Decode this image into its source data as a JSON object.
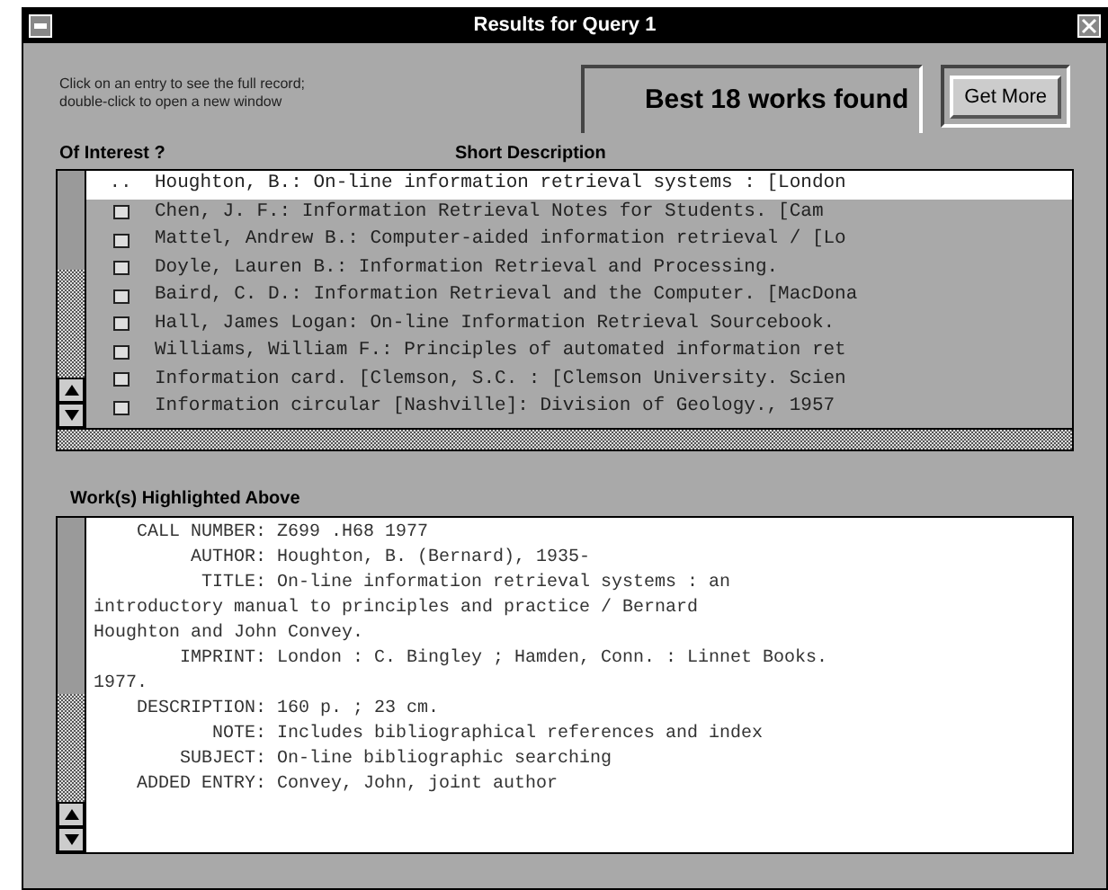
{
  "window": {
    "title": "Results for Query 1"
  },
  "instructions": "Click on an entry to see the full record;\ndouble-click to open a new window",
  "result_count": "Best 18 works found",
  "get_more_button": "Get More",
  "list": {
    "columns": [
      "Of Interest ?",
      "Short Description"
    ],
    "rows": [
      {
        "marker": "..",
        "text": "Houghton, B.: On-line information retrieval systems : [London",
        "selected": true
      },
      {
        "marker": "",
        "text": "Chen, J. F.: Information Retrieval  Notes for Students. [Cam",
        "selected": false
      },
      {
        "marker": "",
        "text": "Mattel, Andrew B.: Computer-aided information retrieval / [Lo",
        "selected": false
      },
      {
        "marker": "",
        "text": "Doyle, Lauren B.: Information Retrieval and Processing.",
        "selected": false
      },
      {
        "marker": "",
        "text": "Baird, C. D.: Information Retrieval and the Computer. [MacDona",
        "selected": false
      },
      {
        "marker": "",
        "text": "Hall, James Logan: On-line Information Retrieval Sourcebook.",
        "selected": false
      },
      {
        "marker": "",
        "text": "Williams, William F.: Principles of automated information ret",
        "selected": false
      },
      {
        "marker": "",
        "text": "Information card. [Clemson, S.C. : [Clemson University. Scien",
        "selected": false
      },
      {
        "marker": "",
        "text": "Information circular  [Nashville]: Division of Geology., 1957",
        "selected": false
      }
    ]
  },
  "detail": {
    "heading": "Work(s) Highlighted Above",
    "fields": [
      {
        "label": "CALL NUMBER:",
        "value": "Z699 .H68 1977"
      },
      {
        "label": "AUTHOR:",
        "value": "Houghton, B. (Bernard), 1935-"
      },
      {
        "label": "TITLE:",
        "value": "On-line information retrieval systems : an",
        "continuation": [
          "introductory manual to principles and practice / Bernard",
          "Houghton and John Convey."
        ]
      },
      {
        "label": "IMPRINT:",
        "value": "London : C. Bingley ; Hamden, Conn. : Linnet Books.",
        "continuation": [
          "1977."
        ]
      },
      {
        "label": "DESCRIPTION:",
        "value": "160 p. ; 23 cm."
      },
      {
        "label": "NOTE:",
        "value": "Includes bibliographical references and index"
      },
      {
        "label": "SUBJECT:",
        "value": "On-line bibliographic searching"
      },
      {
        "label": "ADDED ENTRY:",
        "value": "Convey, John, joint author"
      }
    ]
  }
}
